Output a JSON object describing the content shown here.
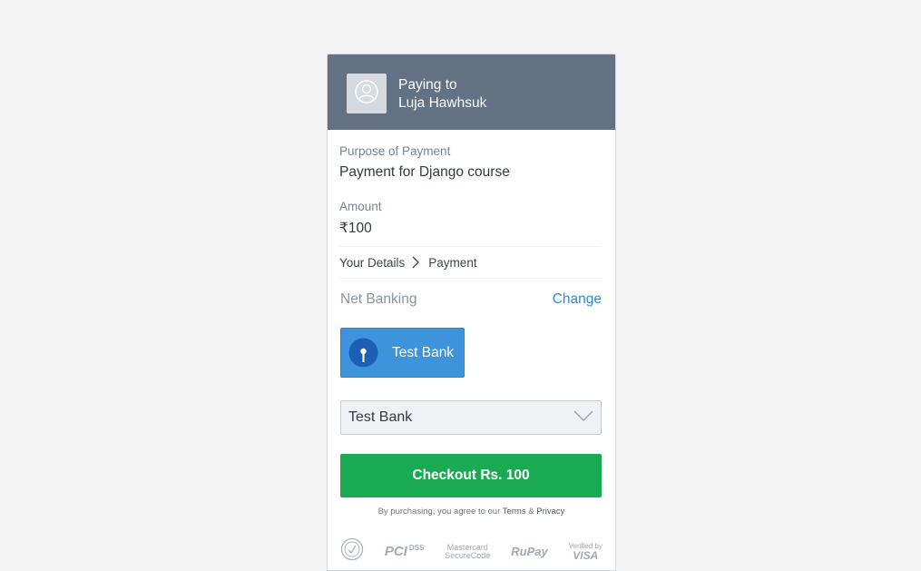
{
  "header": {
    "paying_to_label": "Paying to",
    "payee_name": "Luja Hawhsuk",
    "avatar_icon": "user-circle-icon",
    "background_color": "#627184"
  },
  "purpose": {
    "label": "Purpose of Payment",
    "value": "Payment for Django course"
  },
  "amount": {
    "label": "Amount",
    "currency_symbol": "₹",
    "value": "100"
  },
  "steps": {
    "step1": "Your Details",
    "step2": "Payment",
    "separator_icon": "chevron-right-icon"
  },
  "payment_method": {
    "name": "Net Banking",
    "change_label": "Change"
  },
  "bank_tile": {
    "label": "Test Bank",
    "logo_icon": "bank-logo-icon",
    "color": "#3d94dc"
  },
  "bank_select": {
    "selected": "Test Bank",
    "dropdown_icon": "chevron-down-icon"
  },
  "checkout": {
    "label": "Checkout Rs. 100",
    "color": "#1aab52"
  },
  "terms": {
    "prefix": "By purchasing, you agree to our",
    "link_terms": "Terms",
    "amp": "&",
    "link_privacy": "Privacy"
  },
  "badges": {
    "pci_main": "PCI",
    "pci_sub": "DSS",
    "mastercard_line1": "Mastercard",
    "mastercard_line2": "SecureCode",
    "rupay": "RuPay",
    "visa_line1": "Verified by",
    "visa_line2": "VISA"
  }
}
